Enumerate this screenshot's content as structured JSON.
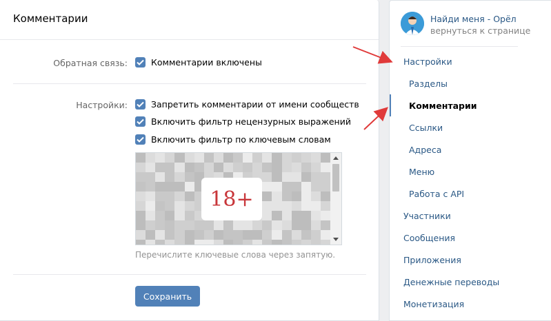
{
  "main": {
    "title": "Комментарии",
    "feedback": {
      "label": "Обратная связь:",
      "option": "Комментарии включены"
    },
    "settings": {
      "label": "Настройки:",
      "options": [
        "Запретить комментарии от имени сообществ",
        "Включить фильтр нецензурных выражений",
        "Включить фильтр по ключевым словам"
      ]
    },
    "keywords_badge": "18+",
    "keywords_hint": "Перечислите ключевые слова через запятую.",
    "save_label": "Сохранить"
  },
  "sidebar": {
    "group_name": "Найди меня - Орёл",
    "back_link": "вернуться к странице",
    "items": [
      {
        "label": "Настройки",
        "level": "top"
      },
      {
        "label": "Разделы",
        "level": "sub"
      },
      {
        "label": "Комментарии",
        "level": "sub",
        "active": true
      },
      {
        "label": "Ссылки",
        "level": "sub"
      },
      {
        "label": "Адреса",
        "level": "sub"
      },
      {
        "label": "Меню",
        "level": "sub"
      },
      {
        "label": "Работа с API",
        "level": "sub"
      },
      {
        "label": "Участники",
        "level": "top"
      },
      {
        "label": "Сообщения",
        "level": "top"
      },
      {
        "label": "Приложения",
        "level": "top"
      },
      {
        "label": "Денежные переводы",
        "level": "top"
      },
      {
        "label": "Монетизация",
        "level": "top"
      }
    ]
  },
  "colors": {
    "accent": "#5181b8",
    "link": "#2a5885",
    "annotation_arrow": "#e03a3a",
    "badge_text": "#c8363a"
  }
}
